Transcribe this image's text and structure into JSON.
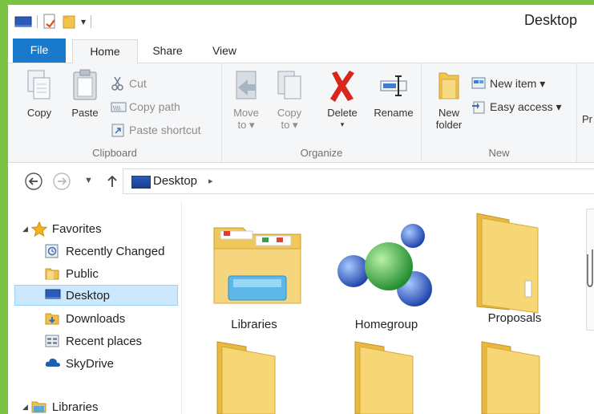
{
  "window": {
    "title": "Desktop"
  },
  "tabs": {
    "file": "File",
    "home": "Home",
    "share": "Share",
    "view": "View"
  },
  "ribbon": {
    "clipboard": {
      "label": "Clipboard",
      "copy": "Copy",
      "paste": "Paste",
      "cut": "Cut",
      "copy_path": "Copy path",
      "paste_shortcut": "Paste shortcut"
    },
    "organize": {
      "label": "Organize",
      "move_to_line1": "Move",
      "move_to_line2": "to ▾",
      "copy_to_line1": "Copy",
      "copy_to_line2": "to ▾",
      "delete": "Delete",
      "delete_arrow": "▾",
      "rename": "Rename"
    },
    "new": {
      "label": "New",
      "new_folder_line1": "New",
      "new_folder_line2": "folder",
      "new_item": "New item ▾",
      "easy_access": "Easy access ▾"
    },
    "open_partial": "Pr"
  },
  "address": {
    "location": "Desktop",
    "chevron": "▸"
  },
  "nav_pane": {
    "favorites": "Favorites",
    "items": [
      {
        "label": "Recently Changed"
      },
      {
        "label": "Public"
      },
      {
        "label": "Desktop"
      },
      {
        "label": "Downloads"
      },
      {
        "label": "Recent places"
      },
      {
        "label": "SkyDrive"
      }
    ],
    "libraries": "Libraries"
  },
  "content": {
    "tiles": [
      {
        "label": "Libraries"
      },
      {
        "label": "Homegroup"
      },
      {
        "label": "Proposals"
      }
    ]
  },
  "colors": {
    "accent": "#1979ca",
    "selection": "#cce8ff",
    "folder": "#f2d37a",
    "frame": "#7cc242"
  }
}
